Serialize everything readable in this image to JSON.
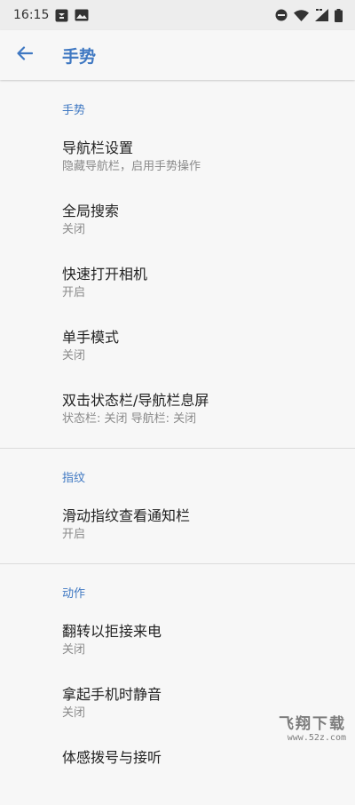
{
  "status_bar": {
    "time": "16:15"
  },
  "app_bar": {
    "title": "手势"
  },
  "sections": [
    {
      "header": "手势",
      "items": [
        {
          "title": "导航栏设置",
          "subtitle": "隐藏导航栏，启用手势操作"
        },
        {
          "title": "全局搜索",
          "subtitle": "关闭"
        },
        {
          "title": "快速打开相机",
          "subtitle": "开启"
        },
        {
          "title": "单手模式",
          "subtitle": "关闭"
        },
        {
          "title": "双击状态栏/导航栏息屏",
          "subtitle": "状态栏: 关闭  导航栏: 关闭"
        }
      ]
    },
    {
      "header": "指纹",
      "items": [
        {
          "title": "滑动指纹查看通知栏",
          "subtitle": "开启"
        }
      ]
    },
    {
      "header": "动作",
      "items": [
        {
          "title": "翻转以拒接来电",
          "subtitle": "关闭"
        },
        {
          "title": "拿起手机时静音",
          "subtitle": "关闭"
        },
        {
          "title": "体感拨号与接听",
          "subtitle": ""
        }
      ]
    }
  ],
  "watermark": {
    "title": "飞翔下载",
    "url": "www.52z.com"
  },
  "colors": {
    "accent": "#3f78c2",
    "background": "#f7f7f7",
    "status_bar": "#ededed"
  }
}
